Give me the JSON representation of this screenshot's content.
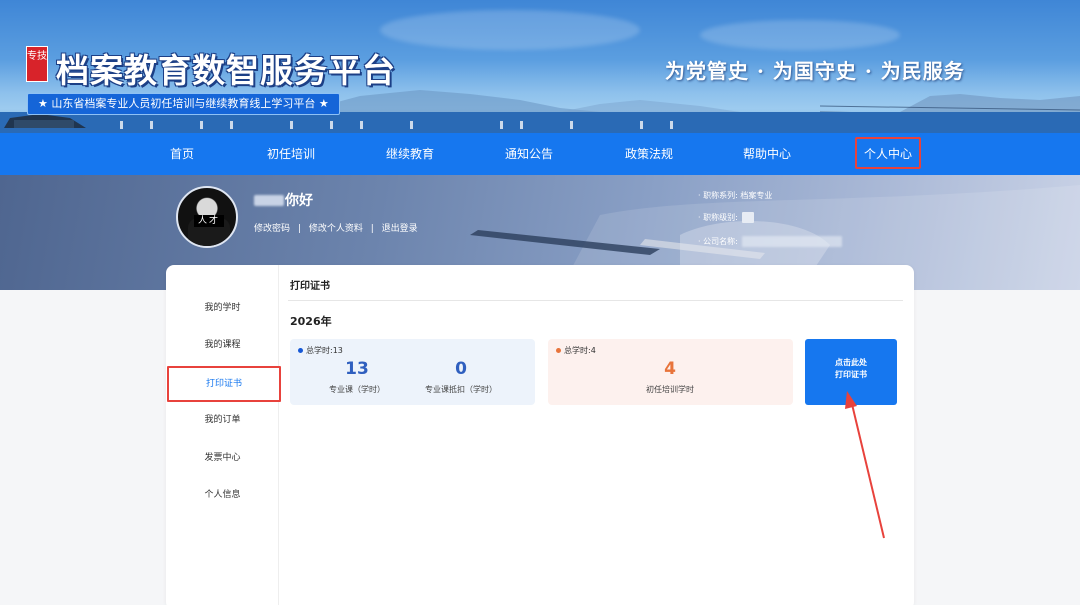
{
  "header": {
    "badge": "专技",
    "title": "档案教育数智服务平台",
    "subtitle": "★ 山东省档案专业人员初任培训与继续教育线上学习平台 ★",
    "slogan": "为党管史 · 为国守史 · 为民服务"
  },
  "nav": {
    "items": [
      {
        "label": "首页"
      },
      {
        "label": "初任培训"
      },
      {
        "label": "继续教育"
      },
      {
        "label": "通知公告"
      },
      {
        "label": "政策法规"
      },
      {
        "label": "帮助中心"
      },
      {
        "label": "个人中心"
      }
    ],
    "active_index": 6
  },
  "profile": {
    "avatar_tag": "人才",
    "greeting": "你好",
    "links": [
      "修改密码",
      "修改个人资料",
      "退出登录"
    ],
    "link_separator": "|",
    "series_label": "· 职称系列:",
    "series_value": "档案专业",
    "level_label": "· 职称级别:",
    "company_label": "· 公司名称:"
  },
  "sidebar": {
    "items": [
      {
        "label": "我的学时"
      },
      {
        "label": "我的课程"
      },
      {
        "label": "打印证书"
      },
      {
        "label": "我的订单"
      },
      {
        "label": "发票中心"
      },
      {
        "label": "个人信息"
      }
    ],
    "active_index": 2
  },
  "content": {
    "title": "打印证书",
    "year": "2026年"
  },
  "stats": {
    "continuing": {
      "total_label": "总学时:13",
      "professional_value": "13",
      "professional_label": "专业课（学时）",
      "offset_value": "0",
      "offset_label": "专业课抵扣（学时）",
      "dot_color": "#1658d6",
      "value_color": "#2f5fbf"
    },
    "initial": {
      "total_label": "总学时:4",
      "value": "4",
      "label": "初任培训学时",
      "dot_color": "#e8743b",
      "value_color": "#e8743b"
    }
  },
  "print_button": {
    "line1": "点击此处",
    "line2": "打印证书"
  },
  "colors": {
    "nav_bg": "#1677ef",
    "highlight": "#e8423c",
    "accent": "#1677ef"
  }
}
